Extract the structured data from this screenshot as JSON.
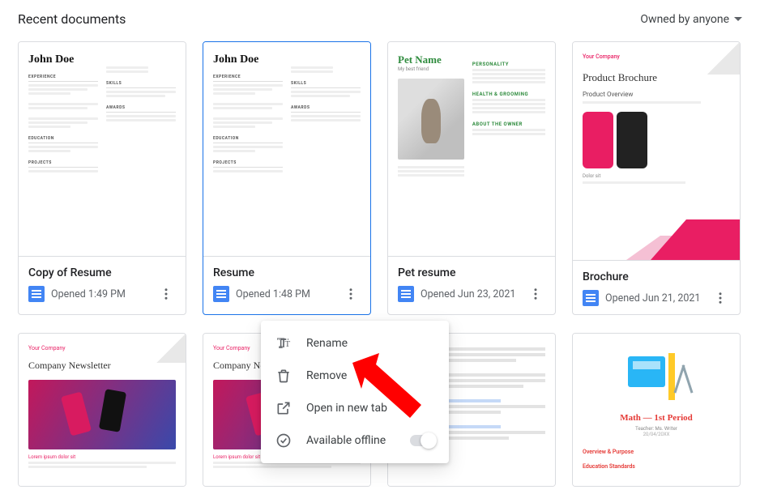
{
  "header": {
    "title": "Recent documents",
    "owner_filter": "Owned by anyone"
  },
  "docs": [
    {
      "title": "Copy of Resume",
      "opened": "Opened 1:49 PM",
      "thumb_name": "John Doe"
    },
    {
      "title": "Resume",
      "opened": "Opened 1:48 PM",
      "thumb_name": "John Doe",
      "selected": true
    },
    {
      "title": "Pet resume",
      "opened": "Opened Jun 23, 2021",
      "thumb_pet": "Pet Name",
      "thumb_sub": "My best friend"
    },
    {
      "title": "Brochure",
      "opened": "Opened Jun 21, 2021",
      "thumb_company": "Your Company",
      "thumb_heading": "Product Brochure",
      "thumb_sub": "Product Overview"
    }
  ],
  "docs2": [
    {
      "thumb_company": "Your Company",
      "thumb_heading": "Company Newsletter",
      "thumb_caption": "Lorem ipsum dolor sit"
    },
    {
      "thumb_company": "Your Company",
      "thumb_heading": "Company Newsletter",
      "thumb_caption": "Lorem ipsum dolor sit"
    },
    {
      "plain": true
    },
    {
      "math_title": "Math — 1st Period",
      "math_teacher": "Teacher: Ms. Writer",
      "math_date": "20/04/20XX",
      "math_overview": "Overview & Purpose",
      "math_standards": "Education Standards"
    }
  ],
  "menu": {
    "rename": "Rename",
    "remove": "Remove",
    "open_new_tab": "Open in new tab",
    "available_offline": "Available offline"
  },
  "thumb_labels": {
    "personality": "PERSONALITY",
    "health": "HEALTH & GROOMING",
    "about_owner": "ABOUT THE OWNER",
    "dolor": "Dolor sit"
  }
}
